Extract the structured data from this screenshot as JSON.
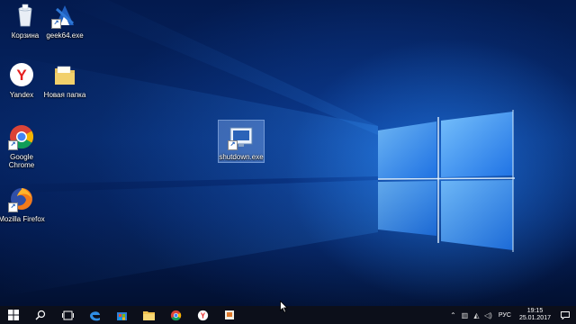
{
  "desktop": {
    "icons": [
      {
        "name": "recycle-bin",
        "label": "Корзина",
        "icon": "recycle-bin-icon"
      },
      {
        "name": "geek64",
        "label": "geek64.exe",
        "icon": "geek-uninstaller-icon"
      },
      {
        "name": "yandex",
        "label": "Yandex",
        "icon": "yandex-browser-icon"
      },
      {
        "name": "new-folder",
        "label": "Новая папка",
        "icon": "folder-icon"
      },
      {
        "name": "google-chrome",
        "label": "Google Chrome",
        "icon": "chrome-icon"
      },
      {
        "name": "mozilla-firefox",
        "label": "Mozilla Firefox",
        "icon": "firefox-icon"
      },
      {
        "name": "shutdown",
        "label": "shutdown.exe",
        "icon": "shutdown-shortcut-icon",
        "selected": true
      }
    ]
  },
  "taskbar": {
    "buttons": [
      {
        "name": "start-button",
        "icon": "windows-logo-icon"
      },
      {
        "name": "search-button",
        "icon": "search-icon"
      },
      {
        "name": "task-view-button",
        "icon": "task-view-icon"
      },
      {
        "name": "edge-button",
        "icon": "edge-icon"
      },
      {
        "name": "store-button",
        "icon": "store-icon"
      },
      {
        "name": "explorer-button",
        "icon": "file-explorer-icon"
      },
      {
        "name": "chrome-button",
        "icon": "chrome-icon"
      },
      {
        "name": "yandex-button",
        "icon": "yandex-browser-icon"
      },
      {
        "name": "presentation-button",
        "icon": "presentation-icon"
      }
    ],
    "tray": {
      "language": "РУС",
      "time": "19:15",
      "date": "25.01.2017"
    }
  },
  "colors": {
    "taskbar": "#0c0f1a",
    "wallpaper_dark": "#031a4e",
    "wallpaper_light": "#2a8cff",
    "selection": "#96beff"
  }
}
